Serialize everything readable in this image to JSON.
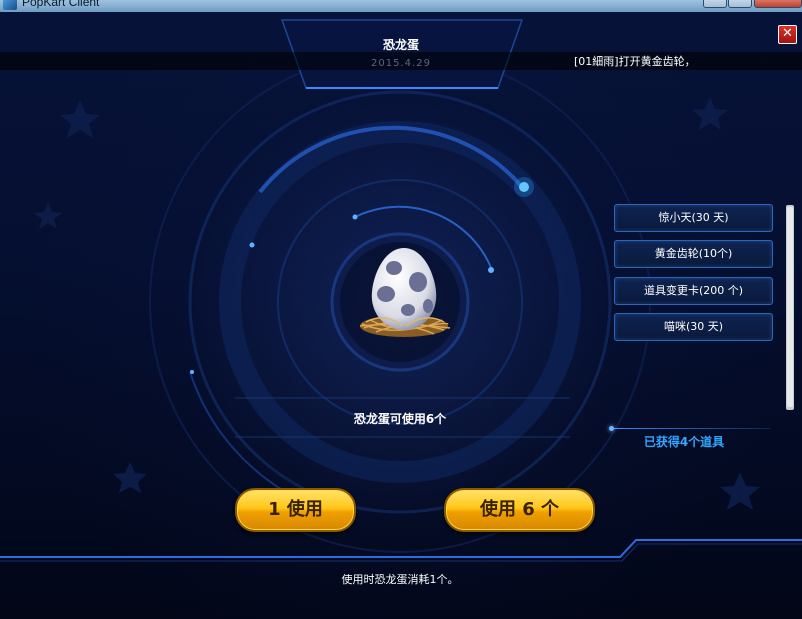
{
  "window": {
    "title": "PopKart Client"
  },
  "header": {
    "title": "恐龙蛋",
    "date": "2015.4.29",
    "ticker": "[01細雨]打开黄金齿轮，"
  },
  "rewards": {
    "items": [
      {
        "label": "惊小天(30 天)"
      },
      {
        "label": "黄金齿轮(10个)"
      },
      {
        "label": "道具变更卡(200 个)"
      },
      {
        "label": "喵咪(30 天)"
      }
    ],
    "obtained_text": "已获得4个道具"
  },
  "main": {
    "status_text": "恐龙蛋可使用6个",
    "use_one_label": "1 使用",
    "use_all_label": "使用 6 个",
    "footer_text": "使用时恐龙蛋消耗1个。"
  },
  "icons": {
    "close": "close-icon",
    "egg": "dinosaur-egg-icon",
    "app": "app-icon"
  },
  "colors": {
    "accent": "#33a6ff",
    "gold": "#ffc61a",
    "close_red": "#e0302a"
  }
}
